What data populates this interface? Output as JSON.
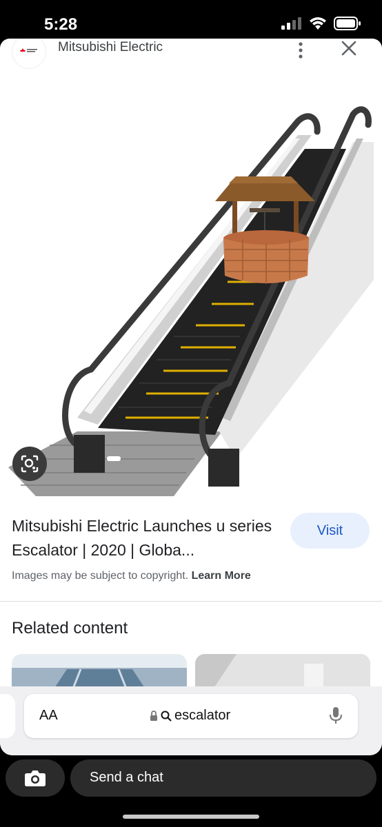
{
  "status_bar": {
    "time": "5:28"
  },
  "header": {
    "source": "Mitsubishi Electric"
  },
  "result": {
    "title": "Mitsubishi Electric Launches u series Escalator | 2020 | Globa...",
    "visit_label": "Visit",
    "copyright": "Images may be subject to copyright.",
    "learn_more": "Learn More"
  },
  "related": {
    "heading": "Related content"
  },
  "browser": {
    "aa_label": "AA",
    "url": "escalator"
  },
  "bottom": {
    "chat_placeholder": "Send a chat"
  },
  "colors": {
    "visit_bg": "#e8f0fe",
    "visit_text": "#1a56c4",
    "chat_bg": "#2b2b2b"
  }
}
